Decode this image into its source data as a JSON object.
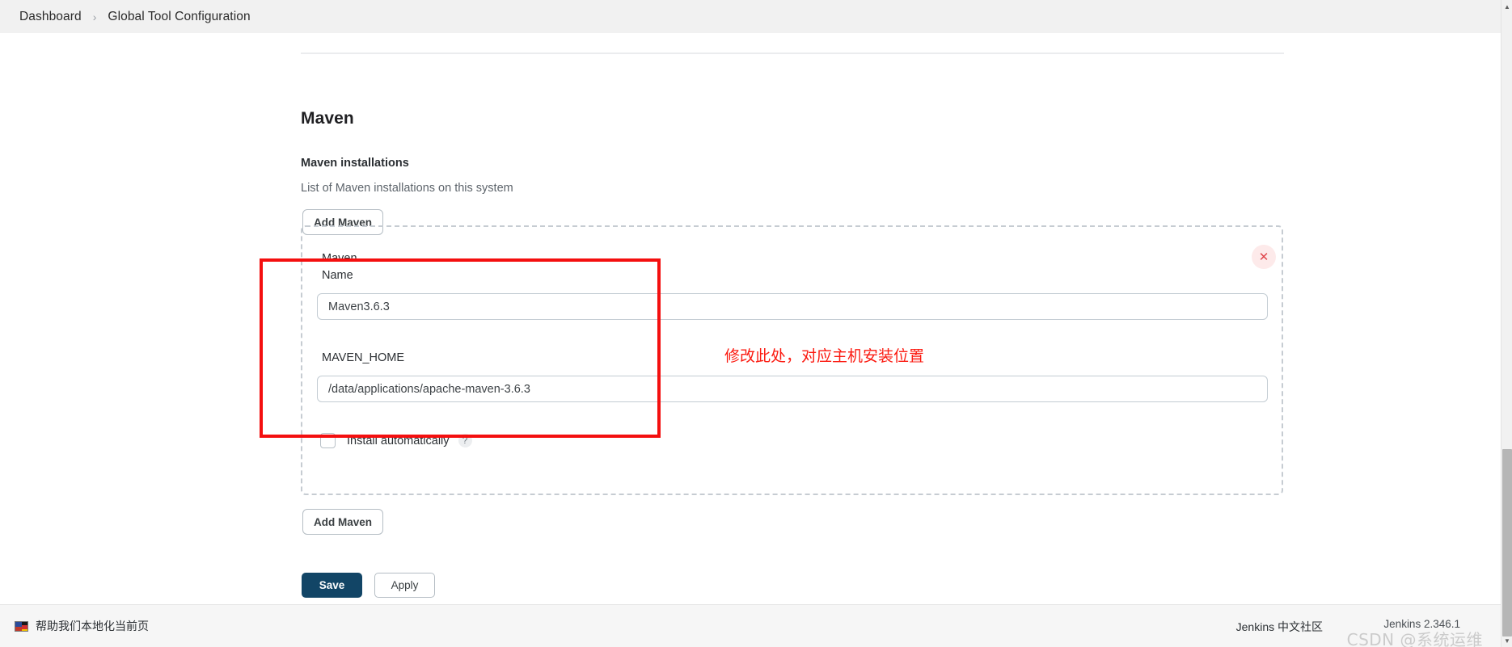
{
  "breadcrumb": {
    "dashboard": "Dashboard",
    "separator": "›",
    "current": "Global Tool Configuration"
  },
  "main": {
    "section_title": "Maven",
    "installations_label": "Maven installations",
    "installations_desc": "List of Maven installations on this system",
    "add_maven_top": "Add Maven",
    "add_maven_bottom": "Add Maven",
    "panel": {
      "title": "Maven",
      "close_icon": "✕",
      "name_label": "Name",
      "name_value": "Maven3.6.3",
      "home_label": "MAVEN_HOME",
      "home_value": "/data/applications/apache-maven-3.6.3",
      "install_automatically_label": "Install automatically",
      "install_automatically_checked": false,
      "help_icon": "?"
    }
  },
  "annotation": {
    "text": "修改此处，对应主机安装位置",
    "color": "#fb1a10"
  },
  "actions": {
    "save": "Save",
    "apply": "Apply",
    "save_color": "#124566"
  },
  "footer": {
    "localize_text": "帮助我们本地化当前页",
    "community": "Jenkins 中文社区",
    "version": "Jenkins 2.346.1",
    "watermark": "CSDN @系统运维"
  },
  "scrollbar": {
    "up_arrow": "▲",
    "down_arrow": "▼"
  }
}
